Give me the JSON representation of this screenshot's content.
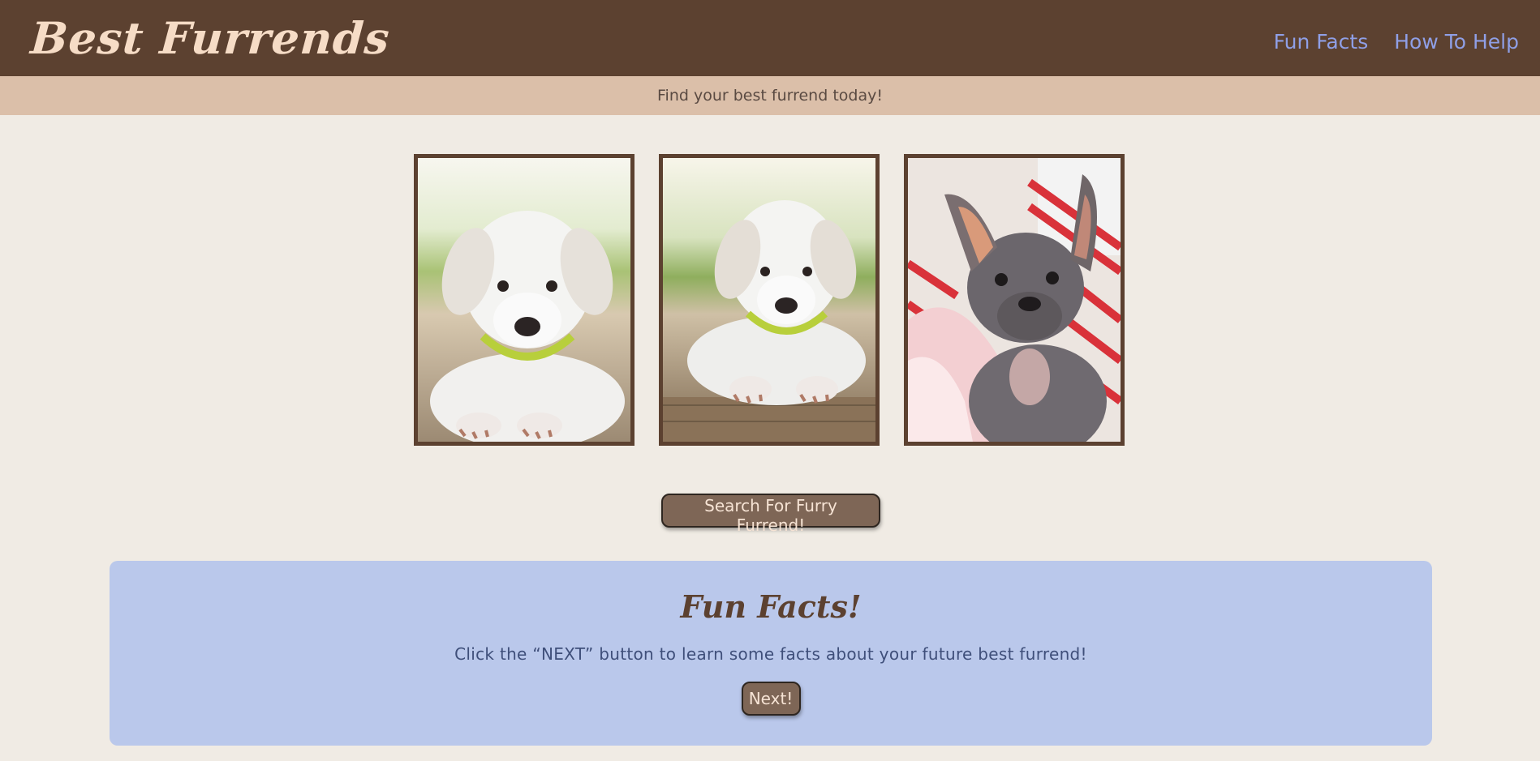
{
  "header": {
    "brand": "Best Furrends",
    "nav": [
      {
        "label": "Fun Facts"
      },
      {
        "label": "How To Help"
      }
    ]
  },
  "tagline": "Find your best furrend today!",
  "gallery": {
    "photos": [
      {
        "subject": "white puppy with green collar"
      },
      {
        "subject": "white puppy lying on wooden deck"
      },
      {
        "subject": "french bulldog with gifts"
      }
    ]
  },
  "search_button": "Search For Furry Furrend!",
  "facts": {
    "title": "Fun Facts!",
    "text": "Click the “NEXT” button to learn some facts about your future best furrend!",
    "next_label": "Next!"
  },
  "colors": {
    "header_bg": "#5c4130",
    "brand_text": "#f6dcc6",
    "nav_link": "#8f9fe6",
    "tagline_bg": "#dbbfa9",
    "page_bg": "#f0ebe4",
    "facts_bg": "#bac8eb",
    "button_bg": "#7e6656"
  }
}
